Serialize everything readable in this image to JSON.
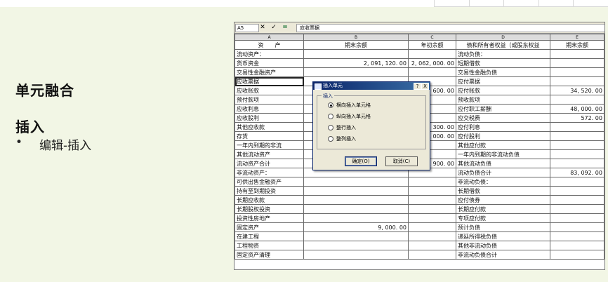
{
  "slide": {
    "title": "单元融合",
    "subtitle": "插入",
    "bullet_mark": "•",
    "bullet_text": "编辑-插入"
  },
  "excel": {
    "name_box": "A5",
    "formula_icons": [
      "close-icon",
      "check-icon",
      "equals-icon"
    ],
    "formula_icon_glyphs": [
      "✕",
      "✓",
      "="
    ],
    "formula_value": "应收票据",
    "columns": [
      "A",
      "B",
      "C",
      "D",
      "E"
    ],
    "header_row": [
      "资　　产",
      "期末余额",
      "年初余额",
      "债和所有者权益（或股东权益",
      "期末余额"
    ],
    "rows": [
      [
        "流动资产：",
        "",
        "",
        "流动负债：",
        ""
      ],
      [
        "货币资金",
        "2, 091, 120. 00",
        "2, 062, 000. 00",
        "短期借款",
        ""
      ],
      [
        "交易性金融资产",
        "",
        "",
        "交易性金融负债",
        ""
      ],
      [
        "应收票据",
        "",
        "",
        "应付票据",
        ""
      ],
      [
        "应收账款",
        "",
        "600. 00",
        "应付账款",
        "34, 520. 00"
      ],
      [
        "预付款项",
        "",
        "",
        "预收款项",
        ""
      ],
      [
        "应收利息",
        "",
        "",
        "应付职工薪酬",
        "48, 000. 00"
      ],
      [
        "应收股利",
        "",
        "",
        "应交税费",
        "572. 00"
      ],
      [
        "其他应收款",
        "",
        "300. 00",
        "应付利息",
        ""
      ],
      [
        "存货",
        "",
        ", 000. 00",
        "应付股利",
        ""
      ],
      [
        "一年内到期的非流",
        "",
        "",
        "其他应付款",
        ""
      ],
      [
        "其他流动资产",
        "",
        "",
        "一年内到期的非流动负债",
        ""
      ],
      [
        "流动资产合计",
        "",
        ", 900. 00",
        "其他流动负债",
        ""
      ],
      [
        "非流动资产：",
        "",
        "",
        "流动负债合计",
        "83, 092. 00"
      ],
      [
        "可供出售金融资产",
        "",
        "",
        "非流动负债：",
        ""
      ],
      [
        "持有至到期投资",
        "",
        "",
        "长期借款",
        ""
      ],
      [
        "长期应收款",
        "",
        "",
        "应付债券",
        ""
      ],
      [
        "长期股权投资",
        "",
        "",
        "长期应付款",
        ""
      ],
      [
        "投资性房地产",
        "",
        "",
        "专项应付款",
        ""
      ],
      [
        "固定资产",
        "9, 000. 00",
        "",
        "预计负债",
        ""
      ],
      [
        "在建工程",
        "",
        "",
        "递延所得税负债",
        ""
      ],
      [
        "工程物资",
        "",
        "",
        "其他非流动负债",
        ""
      ],
      [
        "固定资产清理",
        "",
        "",
        "非流动负债合计",
        ""
      ]
    ]
  },
  "dialog": {
    "title": "插入单元",
    "help_label": "?",
    "close_label": "X",
    "group_label": "插入",
    "options": [
      "横向插入单元格",
      "纵向插入单元格",
      "整行插入",
      "整列插入"
    ],
    "selected_option": "横向插入单元格",
    "ok_label": "确定(O)",
    "cancel_label": "取消(C)"
  }
}
